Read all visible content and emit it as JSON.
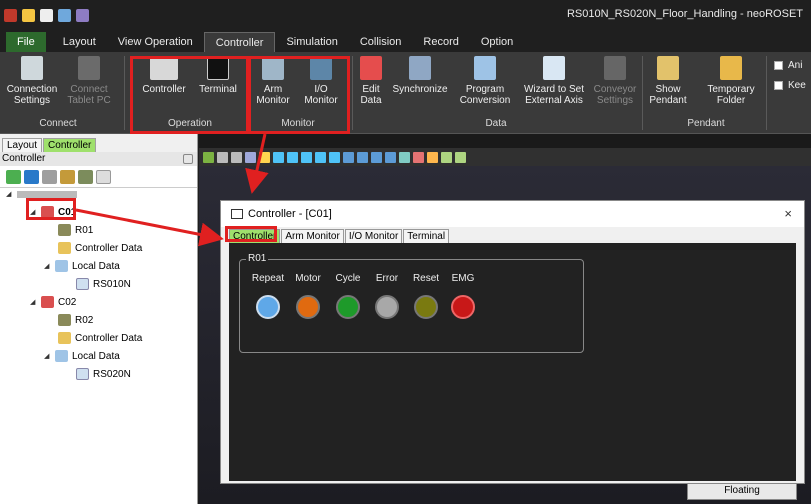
{
  "window": {
    "title": "RS010N_RS020N_Floor_Handling - neoROSET"
  },
  "menu": {
    "tabs": [
      "File",
      "Layout",
      "View Operation",
      "Controller",
      "Simulation",
      "Collision",
      "Record",
      "Option"
    ],
    "active": "Controller"
  },
  "ribbon": {
    "groups": {
      "connect": "Connect",
      "operation": "Operation",
      "monitor": "Monitor",
      "data": "Data",
      "pendant": "Pendant"
    },
    "buttons": {
      "connection_settings": "Connection\nSettings",
      "connect_tablet": "Connect\nTablet PC",
      "controller": "Controller",
      "terminal": "Terminal",
      "arm_monitor": "Arm\nMonitor",
      "io_monitor": "I/O\nMonitor",
      "edit_data": "Edit\nData",
      "synchronize": "Synchronize",
      "program_conversion": "Program\nConversion",
      "wizard_external_axis": "Wizard to Set\nExternal Axis",
      "conveyor_settings": "Conveyor\nSettings",
      "show_pendant": "Show\nPendant",
      "temporary_folder": "Temporary\nFolder"
    },
    "checkboxes": [
      "Ani",
      "Kee"
    ]
  },
  "left_panel": {
    "tabs": [
      "Layout",
      "Controller"
    ],
    "active_tab": "Controller",
    "header": "Controller",
    "tree": [
      {
        "label": "C01",
        "level": 1
      },
      {
        "label": "R01",
        "level": 2
      },
      {
        "label": "Controller Data",
        "level": 2
      },
      {
        "label": "Local Data",
        "level": 2
      },
      {
        "label": "RS010N",
        "level": 3
      },
      {
        "label": "C02",
        "level": 1
      },
      {
        "label": "R02",
        "level": 2
      },
      {
        "label": "Controller Data",
        "level": 2
      },
      {
        "label": "Local Data",
        "level": 2
      },
      {
        "label": "RS020N",
        "level": 3
      }
    ]
  },
  "controller_window": {
    "title": "Controller - [C01]",
    "close": "×",
    "tabs": [
      "Controller",
      "Arm Monitor",
      "I/O Monitor",
      "Terminal"
    ],
    "active_tab": "Controller",
    "group_label": "R01",
    "indicators": [
      {
        "label": "Repeat",
        "color": "#5fa8e8"
      },
      {
        "label": "Motor",
        "color": "#e06a10"
      },
      {
        "label": "Cycle",
        "color": "#1e9a2a"
      },
      {
        "label": "Error",
        "color": "#a8a8a8"
      },
      {
        "label": "Reset",
        "color": "#7a7a10"
      },
      {
        "label": "EMG",
        "color": "#c81818"
      }
    ]
  },
  "floating_button": "Floating",
  "colors": {
    "annotation_red": "#e02020",
    "active_tab_green": "#9fe06c"
  }
}
